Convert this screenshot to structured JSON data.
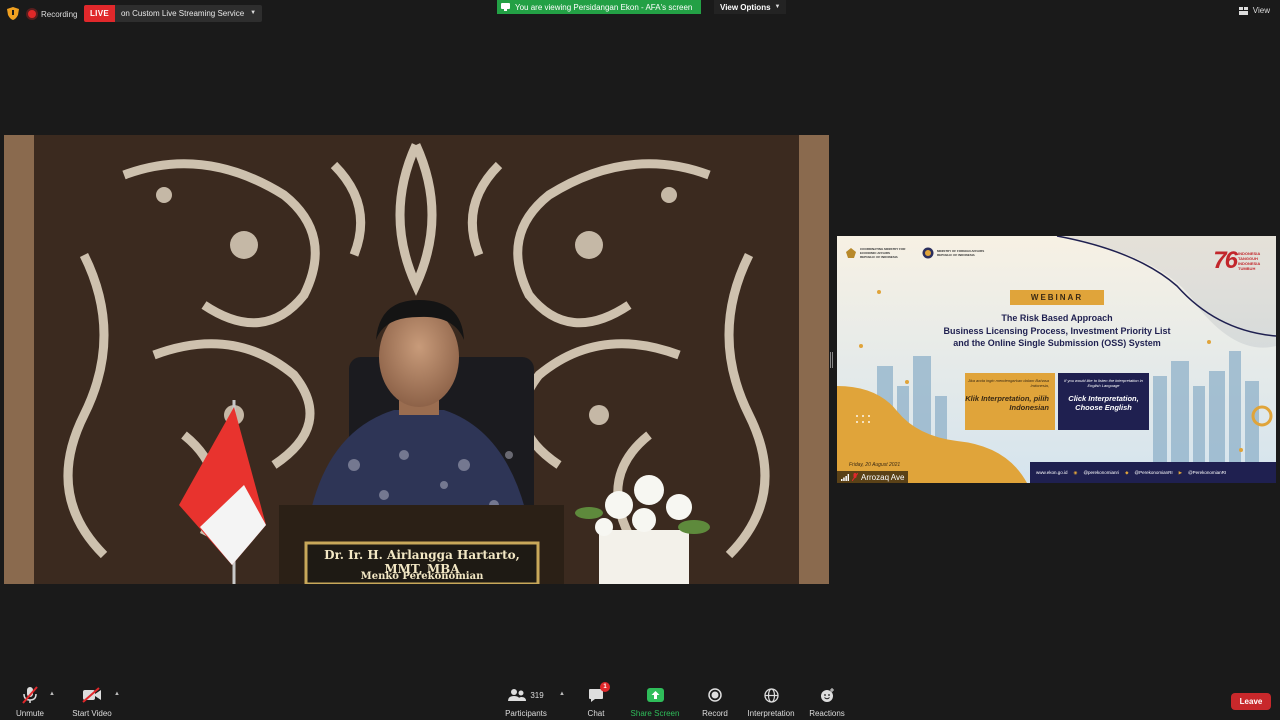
{
  "top_bar": {
    "recording_label": "Recording",
    "live_badge": "LIVE",
    "live_service": "on Custom Live Streaming Service",
    "viewing_banner": "You are viewing Persidangan Ekon - AFA's screen",
    "view_options": "View Options",
    "view_label": "View"
  },
  "main_video": {
    "nameplate_line1": "Dr. Ir. H. Airlangga Hartarto, MMT, MBA",
    "nameplate_line2": "Menko Perekonomian"
  },
  "shared_screen": {
    "logo1": "COORDINATING MINISTRY FOR ECONOMIC AFFAIRS REPUBLIC OF INDONESIA",
    "logo2": "MINISTRY OF FOREIGN AFFAIRS REPUBLIC OF INDONESIA",
    "anniv_number": "76",
    "anniv_tag": "INDONESIA TANGGUH INDONESIA TUMBUH",
    "webinar_label": "WEBINAR",
    "title_line1": "The Risk Based Approach",
    "title_line2": "Business Licensing Process, Investment Priority List",
    "title_line3": "and the Online Single Submission (OSS) System",
    "interp_id_small": "Jika anda ingin mendengarkan dalam Bahasa Indonesia,",
    "interp_id_big": "Klik Interpretation, pilih Indonesian",
    "interp_en_small": "If you would like to listen the interpretation in English Language",
    "interp_en_big": "Click Interpretation, Choose English",
    "date": "Friday, 20 August 2021",
    "footer_web": "www.ekon.go.id",
    "footer_ig": "@perekonomianri",
    "footer_tw": "@PerekonomianRI",
    "footer_yt": "@PerekonomianRI",
    "participant_name": "Arrozaq Ave"
  },
  "toolbar": {
    "unmute": "Unmute",
    "start_video": "Start Video",
    "participants": "Participants",
    "participants_count": "319",
    "chat": "Chat",
    "chat_badge": "1",
    "share_screen": "Share Screen",
    "record": "Record",
    "interpretation": "Interpretation",
    "reactions": "Reactions",
    "leave": "Leave"
  },
  "colors": {
    "share_green": "#23a045",
    "live_red": "#e0282b",
    "leave_red": "#c8282b",
    "webinar_gold": "#e0a43a",
    "webinar_navy": "#1f2050"
  }
}
